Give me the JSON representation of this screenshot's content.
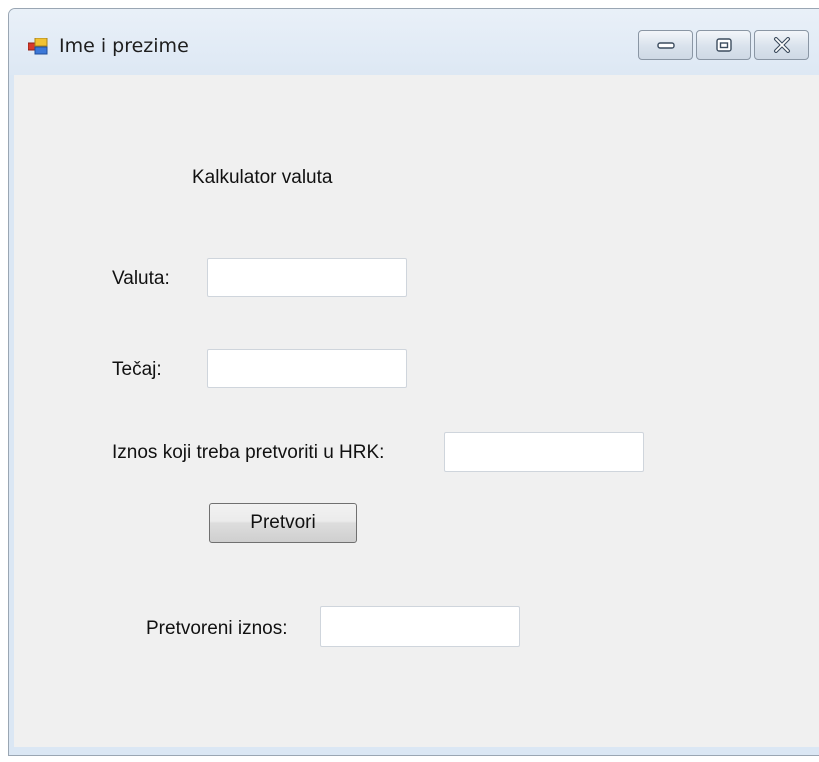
{
  "window": {
    "title": "Ime i prezime",
    "app_icon": "winforms-app-icon",
    "controls": [
      "minimize-icon",
      "maximize-icon",
      "close-icon"
    ]
  },
  "form": {
    "heading": "Kalkulator valuta",
    "currency_label": "Valuta:",
    "currency_value": "",
    "rate_label": "Tečaj:",
    "rate_value": "",
    "amount_label": "Iznos koji treba pretvoriti u HRK:",
    "amount_value": "",
    "convert_button": "Pretvori",
    "result_label": "Pretvoreni iznos:",
    "result_value": ""
  }
}
